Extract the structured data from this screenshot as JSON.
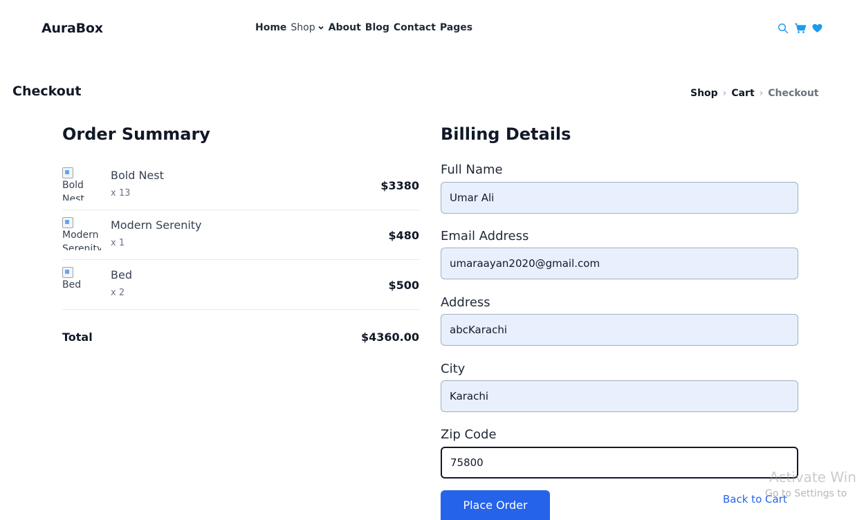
{
  "header": {
    "brand": "AuraBox",
    "nav": {
      "home": "Home",
      "shop": "Shop",
      "about": "About",
      "blog": "Blog",
      "contact": "Contact",
      "pages": "Pages"
    },
    "icons": [
      "search-icon",
      "cart-icon",
      "heart-icon"
    ],
    "accent_color": "#1d9bf0"
  },
  "page": {
    "title": "Checkout",
    "breadcrumb": [
      "Shop",
      "Cart",
      "Checkout"
    ]
  },
  "summary": {
    "title": "Order Summary",
    "items": [
      {
        "image_alt": "Bold Nest",
        "name": "Bold Nest",
        "qty": "x 13",
        "price": "$3380"
      },
      {
        "image_alt": "Modern Serenity",
        "name": "Modern Serenity",
        "qty": "x 1",
        "price": "$480"
      },
      {
        "image_alt": "Bed",
        "name": "Bed",
        "qty": "x 2",
        "price": "$500"
      }
    ],
    "total_label": "Total",
    "total_value": "$4360.00"
  },
  "billing": {
    "title": "Billing Details",
    "fields": {
      "full_name": {
        "label": "Full Name",
        "value": "Umar Ali"
      },
      "email": {
        "label": "Email Address",
        "value": "umaraayan2020@gmail.com"
      },
      "address": {
        "label": "Address",
        "value": "abcKarachi"
      },
      "city": {
        "label": "City",
        "value": "Karachi"
      },
      "zip": {
        "label": "Zip Code",
        "value": "75800"
      }
    },
    "place_order": "Place Order",
    "back_to_cart": "Back to Cart",
    "button_color": "#2563eb"
  },
  "watermark": {
    "line1": "Activate Win",
    "line2": "Go to Settings to"
  }
}
